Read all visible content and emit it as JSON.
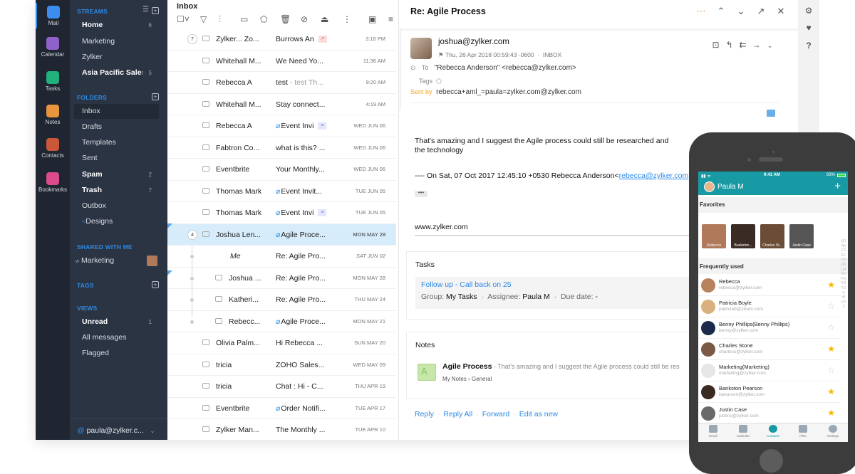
{
  "rail": {
    "items": [
      {
        "label": "Mail",
        "icon": "mail-icon",
        "color": "#3b8df0",
        "active": true
      },
      {
        "label": "Calendar",
        "icon": "calendar-icon",
        "color": "#8f62c9"
      },
      {
        "label": "Tasks",
        "icon": "tasks-icon",
        "color": "#22b07d"
      },
      {
        "label": "Notes",
        "icon": "notes-icon",
        "color": "#e9953d"
      },
      {
        "label": "Contacts",
        "icon": "contacts-icon",
        "color": "#c9573a"
      },
      {
        "label": "Bookmarks",
        "icon": "bookmarks-icon",
        "color": "#d94b8a"
      }
    ]
  },
  "folders": {
    "streams_header": "STREAMS",
    "streams": [
      {
        "label": "Home",
        "count": "6",
        "bold": true
      },
      {
        "label": "Marketing",
        "count": ""
      },
      {
        "label": "Zylker",
        "count": ""
      },
      {
        "label": "Asia Pacific Sales",
        "count": "5",
        "bold": true
      }
    ],
    "folders_header": "FOLDERS",
    "folders": [
      {
        "label": "Inbox",
        "selected": true
      },
      {
        "label": "Drafts"
      },
      {
        "label": "Templates"
      },
      {
        "label": "Sent"
      },
      {
        "label": "Spam",
        "count": "2",
        "bold": true
      },
      {
        "label": "Trash",
        "count": "7",
        "bold": true
      },
      {
        "label": "Outbox"
      },
      {
        "label": "Designs",
        "shared": true
      }
    ],
    "shared_header": "SHARED WITH ME",
    "shared": [
      {
        "prefix": "w",
        "label": "Marketing"
      }
    ],
    "tags_header": "TAGS",
    "views_header": "VIEWS",
    "views": [
      {
        "label": "Unread",
        "count": "1",
        "bold": true
      },
      {
        "label": "All messages"
      },
      {
        "label": "Flagged"
      }
    ],
    "account": "paula@zylker.c..."
  },
  "list": {
    "title": "Inbox",
    "emails": [
      {
        "count": "7",
        "from": "Zylker... Zo...",
        "subject": "Burrows An",
        "date": "3:16 PM",
        "icon": "envelope",
        "tag": "pink"
      },
      {
        "from": "Whitehall M...",
        "subject": "We Need Yo...",
        "date": "11:36 AM",
        "icon": "envelope"
      },
      {
        "from": "Rebecca A",
        "subject": "test",
        "preview": " - test Th...",
        "date": "9:20 AM",
        "icon": "envelope"
      },
      {
        "from": "Whitehall M...",
        "subject": "Stay connect...",
        "date": "4:19 AM",
        "icon": "envelope"
      },
      {
        "from": "Rebecca A",
        "subject": "Event Invi",
        "date": "WED JUN 06",
        "icon": "calendar",
        "attach": true,
        "tag": "purple"
      },
      {
        "from": "Fabtron Co...",
        "subject": "what is this? ...",
        "date": "WED JUN 06",
        "icon": "envelope"
      },
      {
        "from": "Eventbrite",
        "subject": "Your Monthly...",
        "date": "WED JUN 06",
        "icon": "envelope"
      },
      {
        "from": "Thomas Mark",
        "subject": "Event Invit...",
        "date": "TUE JUN 05",
        "icon": "calendar",
        "attach": true
      },
      {
        "from": "Thomas Mark",
        "subject": "Event Invi",
        "date": "TUE JUN 05",
        "icon": "calendar",
        "attach": true,
        "tag": "purple"
      },
      {
        "count": "4",
        "from": "Joshua Len...",
        "subject": "Agile Proce...",
        "date": "MON MAY 28",
        "icon": "envelope",
        "attach": true,
        "selected": true
      },
      {
        "from": "Me",
        "subject": "Re: Agile Pro...",
        "date": "SAT JUN 02",
        "italic": true,
        "child": true
      },
      {
        "from": "Joshua ...",
        "subject": "Re: Agile Pro...",
        "date": "MON MAY 28",
        "icon": "envelope",
        "child": true
      },
      {
        "from": "Katheri...",
        "subject": "Re: Agile Pro...",
        "date": "THU MAY 24",
        "icon": "envelope",
        "child": true
      },
      {
        "from": "Rebecc...",
        "subject": "Agile Proce...",
        "date": "MON MAY 21",
        "icon": "envelope",
        "attach": true,
        "child": true
      },
      {
        "from": "Olivia Palm...",
        "subject": "Hi Rebecca ...",
        "date": "SUN MAY 20",
        "icon": "envelope"
      },
      {
        "from": "tricia",
        "subject": "ZOHO Sales...",
        "date": "WED MAY 09",
        "icon": "envelope"
      },
      {
        "from": "tricia",
        "subject": "Chat : Hi - C...",
        "date": "THU APR 19",
        "icon": "envelope"
      },
      {
        "from": "Eventbrite",
        "subject": "Order Notifi...",
        "date": "TUE APR 17",
        "icon": "envelope",
        "attach": true
      },
      {
        "from": "Zylker Man...",
        "subject": "The Monthly ...",
        "date": "TUE APR 10",
        "icon": "envelope"
      }
    ]
  },
  "reader": {
    "subject": "Re: Agile Process",
    "from": "joshua@zylker.com",
    "date": "Thu, 26 Apr 2018 00:59:43 -0600",
    "folder": "INBOX",
    "to_label": "To",
    "to": "\"Rebecca Anderson\" <rebecca@zylker.com>",
    "tags_label": "Tags",
    "sentby_label": "Sent by",
    "sentby": "rebecca+aml_=paula=zylker.com@zylker.com",
    "body_line1": "That's amazing  and I suggest the Agile process could still be researched and",
    "body_line2": "the technology",
    "quote_prefix": "---- On Sat, 07 Oct 2017 12:45:10 +0530 Rebecca Anderson<",
    "quote_link": "rebecca@zylker.com",
    "ellipsis": "•••",
    "signature": "www.zylker.com",
    "tasks": {
      "title": "Tasks",
      "task_title": "Follow up - Call back on 25",
      "group_label": "Group:",
      "group": "My Tasks",
      "assignee_label": "Assignee:",
      "assignee": "Paula M",
      "due_label": "Due date:",
      "due": "-"
    },
    "notes": {
      "title": "Notes",
      "avatar_letter": "A",
      "note_title": "Agile Process",
      "note_preview": " - That's amazing and I suggest the Agile process could still be res",
      "path": "My Notes › General"
    },
    "actions": [
      "Reply",
      "Reply All",
      "Forward",
      "Edit as new"
    ]
  },
  "phone": {
    "time": "9:41 AM",
    "battery": "83%",
    "user": "Paula M",
    "favorites_header": "Favorites",
    "favorites": [
      {
        "name": "Rebecca",
        "color": "#b07a5a"
      },
      {
        "name": "Bankston...",
        "color": "#3a2b24"
      },
      {
        "name": "Charles St...",
        "color": "#6b4c36"
      },
      {
        "name": "Justin Case",
        "color": "#555"
      }
    ],
    "frequent_header": "Frequently used",
    "contacts": [
      {
        "name": "Rebecca",
        "email": "rebecca@zylker.com",
        "starred": true,
        "color": "#b8825d"
      },
      {
        "name": "Patricia Boyle",
        "email": "patriciab@zillum.com",
        "starred": false,
        "color": "#d9b07e"
      },
      {
        "name": "Benny Phillips(Benny Phillips)",
        "email": "benny@zylker.com",
        "starred": false,
        "color": "#1d2b4a"
      },
      {
        "name": "Charles Stone",
        "email": "charless@zylker.com",
        "starred": true,
        "color": "#7a5a44"
      },
      {
        "name": "Marketing(Marketing)",
        "email": "marketing@zylker.com",
        "starred": false,
        "color": "#e6e6e6"
      },
      {
        "name": "Bankston Pearson",
        "email": "bpearson@zylker.com",
        "starred": true,
        "color": "#3a2a22"
      },
      {
        "name": "Justin Case",
        "email": "justinc@zylker.com",
        "starred": true,
        "color": "#6a6a6a"
      }
    ],
    "alphabet": "@1ABCDEFGHIJKLMNOPQRSTUVWXYZ",
    "tabs": [
      {
        "label": "Email"
      },
      {
        "label": "Calendar"
      },
      {
        "label": "Contacts",
        "active": true
      },
      {
        "label": "Files"
      },
      {
        "label": "Settings"
      }
    ]
  }
}
